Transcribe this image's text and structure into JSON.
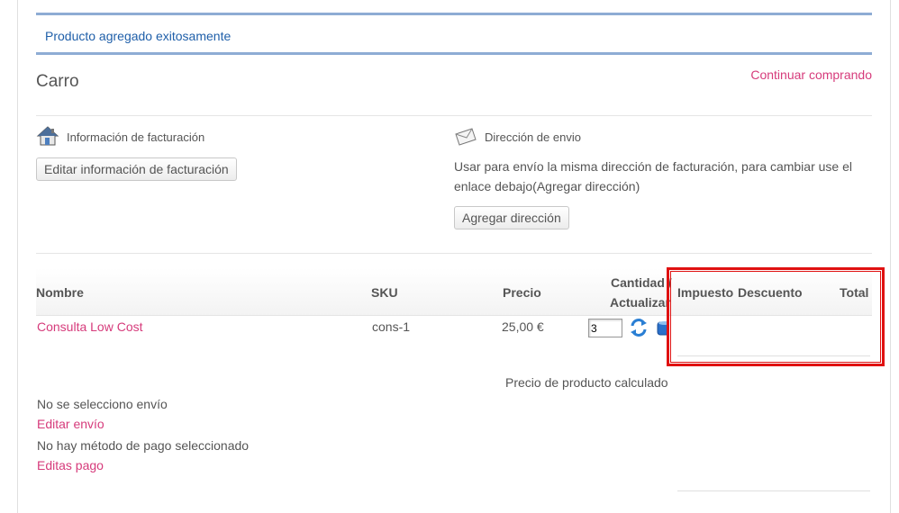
{
  "alert": {
    "message": "Producto agregado exitosamente"
  },
  "header": {
    "title": "Carro",
    "continue_label": "Continuar comprando"
  },
  "billing": {
    "heading": "Información de facturación",
    "edit_button": "Editar información de facturación",
    "icon": "house-icon"
  },
  "shipping": {
    "heading": "Dirección de envio",
    "description": "Usar para envío la misma dirección de facturación, para cambiar use el enlace debajo(Agregar dirección)",
    "add_button": "Agregar dirección",
    "icon": "envelope-icon"
  },
  "table": {
    "headers": {
      "name": "Nombre",
      "sku": "SKU",
      "price": "Precio",
      "qty_line1": "Cantidad /",
      "qty_line2": "Actualizar",
      "tax": "Impuesto",
      "discount": "Descuento",
      "total": "Total"
    },
    "rows": [
      {
        "name": "Consulta Low Cost",
        "sku": "cons-1",
        "price": "25,00 €",
        "qty": "3"
      }
    ]
  },
  "summary": {
    "calculated_label": "Precio de producto calculado",
    "no_shipping": "No se selecciono envío",
    "edit_shipping": "Editar envío",
    "no_payment": "No hay método de pago seleccionado",
    "edit_payment": "Editas pago"
  },
  "colors": {
    "accent_link": "#d63b7b",
    "alert_border": "#8eacd4",
    "alert_text": "#1f5fa9",
    "highlight": "#e01111"
  }
}
